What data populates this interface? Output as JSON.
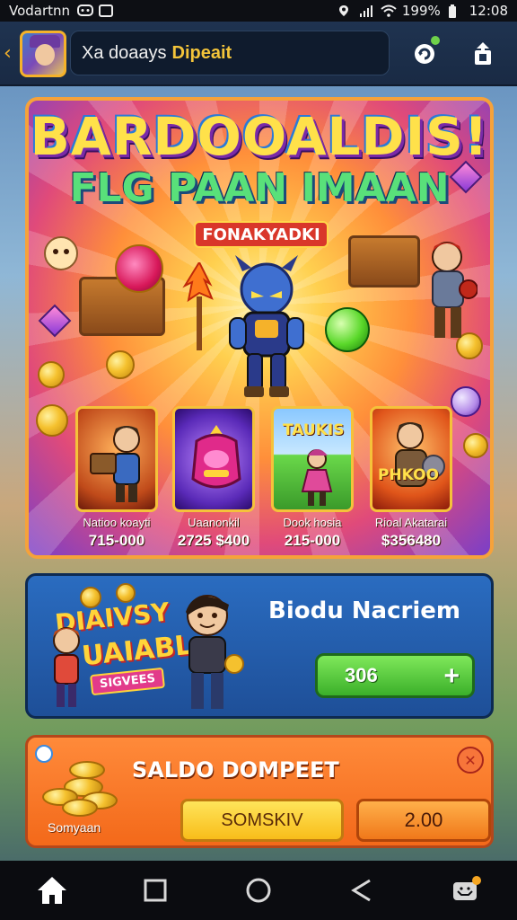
{
  "status_bar": {
    "carrier": "Vodartnn",
    "battery": "199%",
    "time": "12:08"
  },
  "header": {
    "title": "Xa doaays",
    "title_accent": "Dipeait"
  },
  "banner": {
    "title": "BARDOOALDIS!",
    "subtitle": "FLG PAAN IMAAN",
    "tag": "FONAKYADKI",
    "cards": [
      {
        "name": "",
        "label": "Natioo koayti",
        "price": "715-000"
      },
      {
        "name": "",
        "label": "Uaanonkil",
        "price": "2725 $400"
      },
      {
        "name": "TAUKIS",
        "label": "Dook hosia",
        "price": "215-000"
      },
      {
        "name": "PHKOO",
        "label": "Rioal Akatarai",
        "price": "$356480"
      }
    ]
  },
  "promo": {
    "logo_line1": "DIAIVSY",
    "logo_line2": "UAIABL",
    "logo_badge": "SIGVEES",
    "title": "Biodu Nacriem",
    "button_value": "306"
  },
  "saldo": {
    "title": "SALDO DOMPEET",
    "coins_label": "Somyaan",
    "button_left": "SOMSKIV",
    "button_right": "2.00"
  },
  "colors": {
    "accent_yellow": "#f5b22a",
    "green_button": "#3bb02a",
    "orange_panel": "#f3691a",
    "blue_panel": "#1e4f98"
  }
}
